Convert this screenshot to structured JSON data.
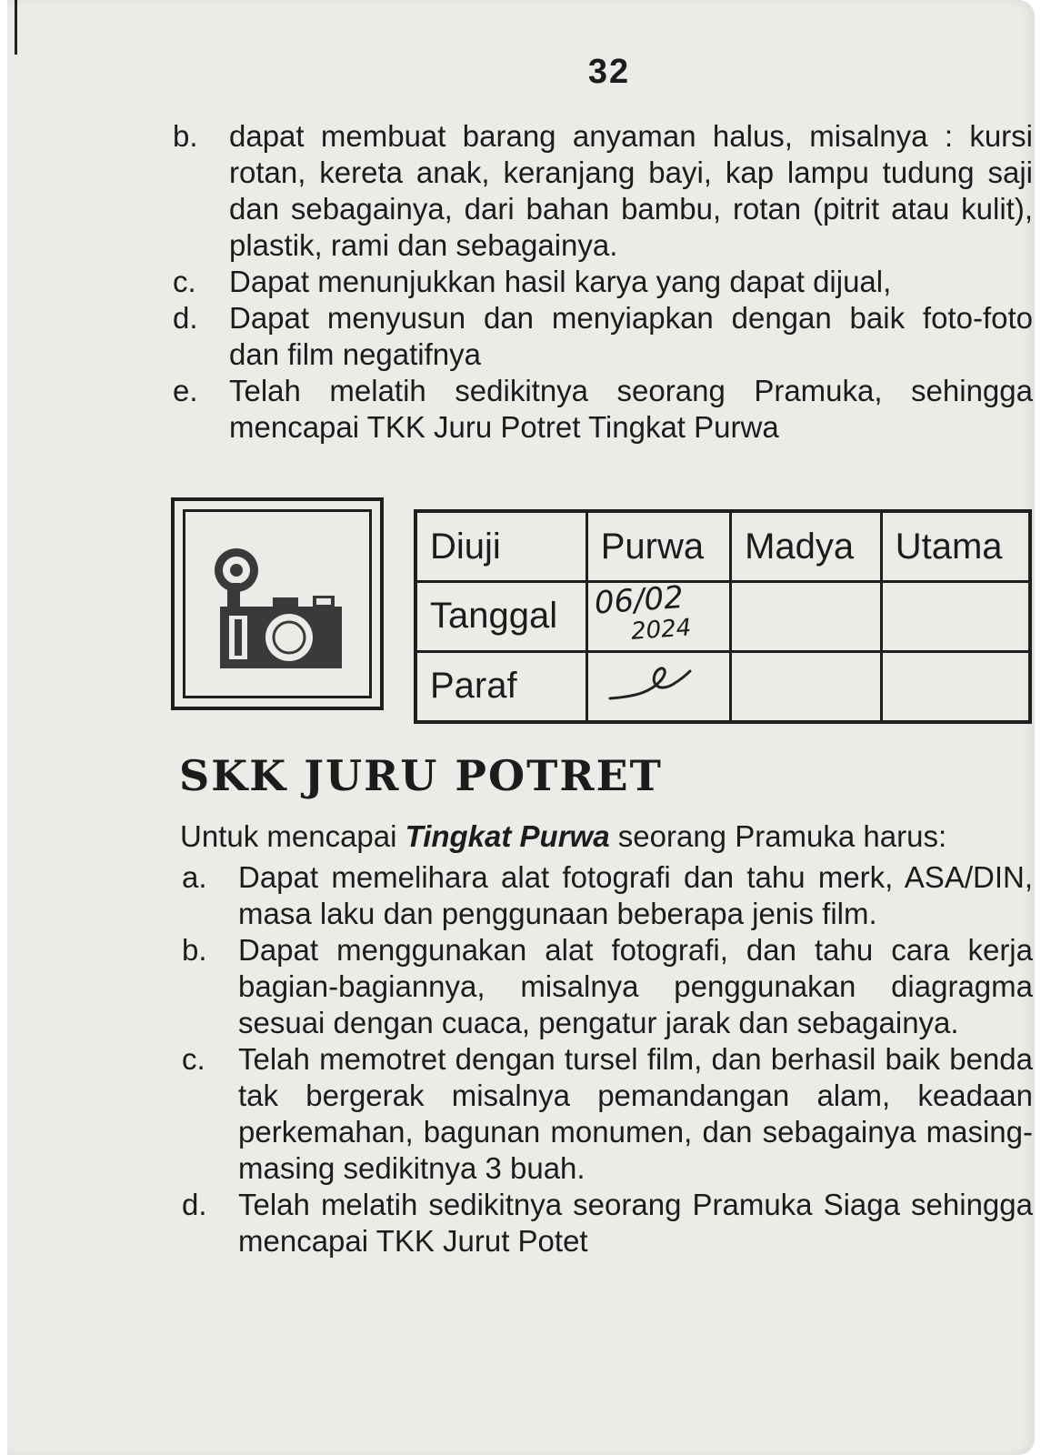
{
  "page_number": "32",
  "top_list": [
    {
      "letter": "b.",
      "text": "dapat membuat barang anyaman halus, misalnya : kursi rotan, kereta anak, keranjang bayi, kap lampu tudung saji dan sebagainya, dari bahan bambu, rotan (pitrit atau kulit), plastik, rami dan sebagainya."
    },
    {
      "letter": "c.",
      "text": "Dapat menunjukkan hasil karya yang dapat dijual,"
    },
    {
      "letter": "d.",
      "text": "Dapat menyusun dan menyiapkan dengan baik foto-foto dan film negatifnya"
    },
    {
      "letter": "e.",
      "text": "Telah melatih sedikitnya seorang Pramuka, sehingga mencapai TKK Juru Potret Tingkat Purwa"
    }
  ],
  "badge": {
    "icon": "camera-icon"
  },
  "exam_table": {
    "headers": [
      "Diuji",
      "Purwa",
      "Madya",
      "Utama"
    ],
    "rows": [
      {
        "label": "Tanggal",
        "purwa_day": "06/02",
        "purwa_year": "2024",
        "madya": "",
        "utama": ""
      },
      {
        "label": "Paraf",
        "purwa": "",
        "madya": "",
        "utama": ""
      }
    ]
  },
  "section_title": "SKK JURU POTRET",
  "intro": {
    "before": "Untuk mencapai",
    "emphasis": "Tingkat Purwa",
    "after": "seorang Pramuka harus:"
  },
  "bottom_list": [
    {
      "letter": "a.",
      "text": "Dapat memelihara alat fotografi dan tahu merk, ASA/DIN, masa laku dan penggunaan beberapa jenis film."
    },
    {
      "letter": "b.",
      "text": "Dapat menggunakan alat fotografi, dan tahu cara kerja bagian-bagiannya, misalnya penggunakan diagragma sesuai dengan cuaca, pengatur jarak dan sebagainya."
    },
    {
      "letter": "c.",
      "text": "Telah memotret dengan tursel film, dan berhasil baik benda tak bergerak misalnya pemandangan alam, keadaan perkemahan, bagunan monumen, dan sebagainya masing-masing sedikitnya 3 buah."
    },
    {
      "letter": "d.",
      "text": "Telah melatih sedikitnya seorang Pramuka Siaga sehingga mencapai TKK Jurut Potet"
    }
  ]
}
